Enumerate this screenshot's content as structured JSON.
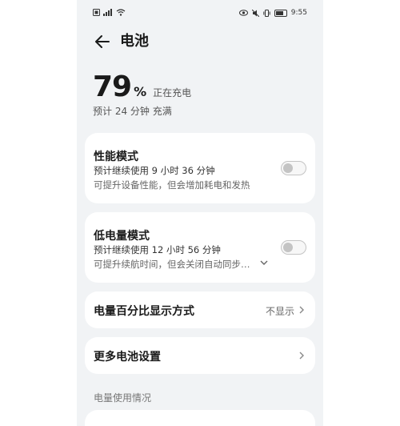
{
  "status_bar": {
    "left_icons": [
      "sim-card-icon",
      "signal-icon",
      "wifi-icon"
    ],
    "time": "9:55",
    "right_icons": [
      "eye-icon",
      "mute-icon",
      "vibrate-icon",
      "battery-icon"
    ]
  },
  "header": {
    "title": "电池"
  },
  "battery": {
    "level": "79",
    "unit": "%",
    "status": "正在充电",
    "eta": "预计 24 分钟 充满"
  },
  "performance_mode": {
    "title": "性能模式",
    "subtitle": "预计继续使用 9 小时 36 分钟",
    "description": "可提升设备性能，但会增加耗电和发热",
    "enabled": false
  },
  "low_power_mode": {
    "title": "低电量模式",
    "subtitle": "预计继续使用 12 小时 56 分钟",
    "description": "可提升续航时间，但会关闭自动同步…",
    "enabled": false
  },
  "percentage_display": {
    "label": "电量百分比显示方式",
    "value": "不显示"
  },
  "more_settings": {
    "label": "更多电池设置"
  },
  "usage_section": {
    "label": "电量使用情况"
  },
  "colors": {
    "page_bg": "#f1f3f5",
    "card_bg": "#ffffff",
    "toggle_off": "#c4c4c4"
  }
}
